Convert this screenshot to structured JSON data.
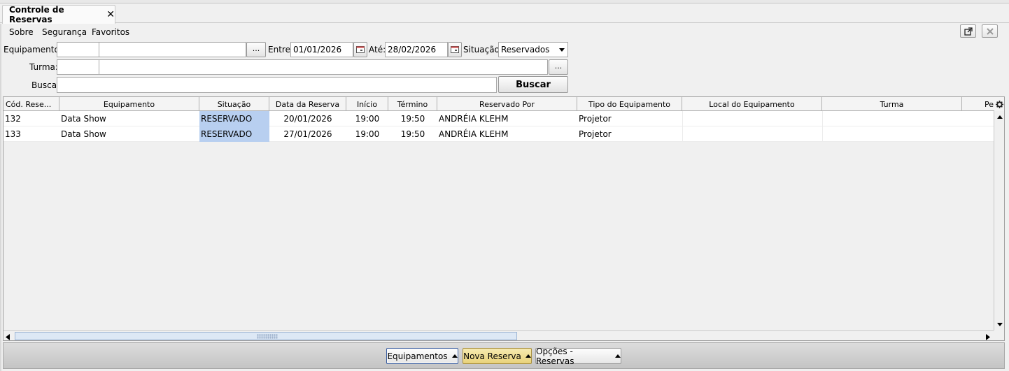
{
  "tab": {
    "title": "Controle de Reservas",
    "close_glyph": "✕"
  },
  "menu": {
    "items": [
      "Sobre",
      "Segurança",
      "Favoritos"
    ]
  },
  "icons": {
    "popout": "popout-icon",
    "close_window": "close-window-icon",
    "calendar": "calendar-icon",
    "gear": "gear-icon"
  },
  "filters": {
    "equipamento_label": "Equipamento:",
    "equipamento_code": "",
    "equipamento_name": "",
    "dots": "...",
    "entre_label": "Entre:",
    "entre_value": "01/01/2026",
    "ate_label": "Até:",
    "ate_value": "28/02/2026",
    "situacao_label": "Situação:",
    "situacao_value": "Reservados",
    "turma_label": "Turma:",
    "turma_code": "",
    "turma_name": "",
    "busca_label": "Busca:",
    "busca_value": "",
    "buscar_button": "Buscar"
  },
  "table": {
    "columns": [
      "Cód. Rese...",
      "Equipamento",
      "Situação",
      "Data da Reserva",
      "Início",
      "Término",
      "Reservado Por",
      "Tipo do Equipamento",
      "Local do Equipamento",
      "Turma",
      "Pe"
    ],
    "rows": [
      {
        "codigo": "132",
        "equipamento": "Data Show",
        "situacao": "RESERVADO",
        "data": "20/01/2026",
        "inicio": "19:00",
        "termino": "19:50",
        "reservado_por": "ANDRÉIA KLEHM",
        "tipo": "Projetor",
        "local": "",
        "turma": ""
      },
      {
        "codigo": "133",
        "equipamento": "Data Show",
        "situacao": "RESERVADO",
        "data": "27/01/2026",
        "inicio": "19:00",
        "termino": "19:50",
        "reservado_por": "ANDRÉIA KLEHM",
        "tipo": "Projetor",
        "local": "",
        "turma": ""
      }
    ]
  },
  "bottom": {
    "equipamentos": "Equipamentos",
    "nova_reserva": "Nova Reserva",
    "opcoes": "Opções - Reservas"
  },
  "colors": {
    "selected_cell": "#b8cff0",
    "nova_reserva_bg": "#e8d27a"
  }
}
